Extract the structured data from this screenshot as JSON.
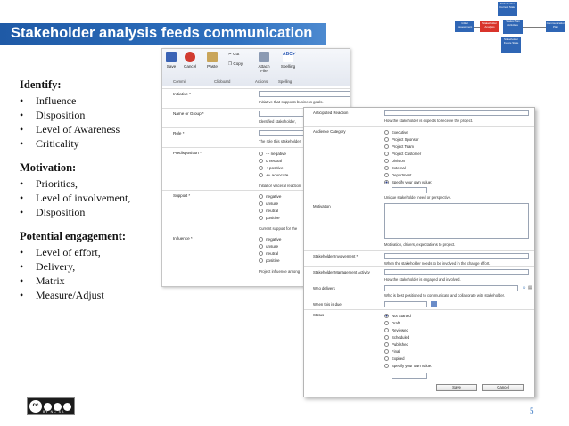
{
  "title": "Stakeholder analysis feeds communication",
  "flow_diagram": {
    "boxes": [
      {
        "label": "Stakeholder Current State",
        "color": "#2f66b5"
      },
      {
        "label": "Initial Assessment",
        "color": "#2f66b5"
      },
      {
        "label": "Stakeholder Analysis",
        "color": "#d9342b"
      },
      {
        "label": "Status Plan Activities",
        "color": "#2f66b5"
      },
      {
        "label": "Communication Plan",
        "color": "#2f66b5"
      },
      {
        "label": "Stakeholder Future State",
        "color": "#2f66b5"
      }
    ]
  },
  "sections": [
    {
      "heading": "Identify:",
      "items": [
        "Influence",
        "Disposition",
        "Level of Awareness",
        "Criticality"
      ]
    },
    {
      "heading": "Motivation:",
      "items": [
        "Priorities,",
        "Level of involvement,",
        "Disposition"
      ]
    },
    {
      "heading": "Potential engagement:",
      "items": [
        "Level of effort,",
        "Delivery,",
        "Matrix",
        "Measure/Adjust"
      ]
    }
  ],
  "ribbon": {
    "buttons": [
      "Save",
      "Cancel",
      "Paste",
      "Cut",
      "Copy",
      "Attach File",
      "Spelling"
    ],
    "groups": [
      "Commit",
      "Clipboard",
      "Actions",
      "Spelling"
    ]
  },
  "form1": {
    "initiative_label": "Initiative *",
    "initiative_hint": "Initiative that supports business goals.",
    "name_label": "Name or Group *",
    "name_hint": "Identified stakeholder,",
    "role_label": "Role *",
    "role_hint": "The role this stakeholder",
    "predisposition_label": "Predisposition *",
    "predisposition_options": [
      "- - negative",
      "0 neutral",
      "+ positive",
      "++ advocate"
    ],
    "predisposition_hint": "Initial or visceral reaction",
    "support_label": "Support *",
    "support_options": [
      "negative",
      "unsure",
      "neutral",
      "positive"
    ],
    "support_hint": "Current support for the",
    "influence_label": "Influence *",
    "influence_options": [
      "negative",
      "unsure",
      "neutral",
      "positive"
    ],
    "influence_hint": "Project influence among"
  },
  "form2": {
    "anticipated_label": "Anticipated Reaction",
    "anticipated_hint": "How the stakeholder is expects to receive the project.",
    "audience_label": "Audience Category",
    "audience_options": [
      "Executive",
      "Project Sponsor",
      "Project Team",
      "Project Customer",
      "Division",
      "External",
      "Department",
      "Specify your own value:"
    ],
    "audience_hint": "Unique stakeholder need or perspective.",
    "motivation_label": "Motivation",
    "motivation_hint": "Motivation, drivers, expectations to project.",
    "involvement_label": "Stakeholder Involvement *",
    "involvement_hint": "When the stakeholder needs to be involved in the change effort.",
    "mgmt_label": "Stakeholder Management Activity",
    "mgmt_hint": "How the stakeholder is engaged and involved.",
    "delivers_label": "Who delivers",
    "delivers_hint": "Who is best positioned to communicate and collaborate with stakeholder.",
    "due_label": "When this is due",
    "status_label": "Status",
    "status_options": [
      "Not Started",
      "Draft",
      "Reviewed",
      "Scheduled",
      "Published",
      "Final",
      "Expired",
      "Specify your own value:"
    ],
    "save_label": "Save",
    "cancel_label": "Cancel"
  },
  "license": {
    "badge": "cc",
    "text": "BY  NC  SA"
  },
  "page_number": "5"
}
